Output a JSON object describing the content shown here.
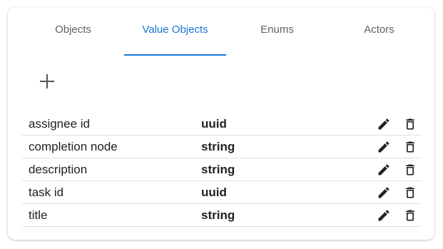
{
  "tabs": [
    {
      "label": "Objects",
      "active": false
    },
    {
      "label": "Value Objects",
      "active": true
    },
    {
      "label": "Enums",
      "active": false
    },
    {
      "label": "Actors",
      "active": false
    }
  ],
  "add_button": {
    "icon": "plus-icon"
  },
  "rows": [
    {
      "name": "assignee id",
      "type": "uuid"
    },
    {
      "name": "completion node",
      "type": "string"
    },
    {
      "name": "description",
      "type": "string"
    },
    {
      "name": "task id",
      "type": "uuid"
    },
    {
      "name": "title",
      "type": "string"
    }
  ],
  "row_actions": {
    "edit_icon": "pencil-icon",
    "delete_icon": "trash-icon"
  },
  "colors": {
    "accent": "#1976d2",
    "tab_text": "#616161",
    "icon": "#212121"
  }
}
